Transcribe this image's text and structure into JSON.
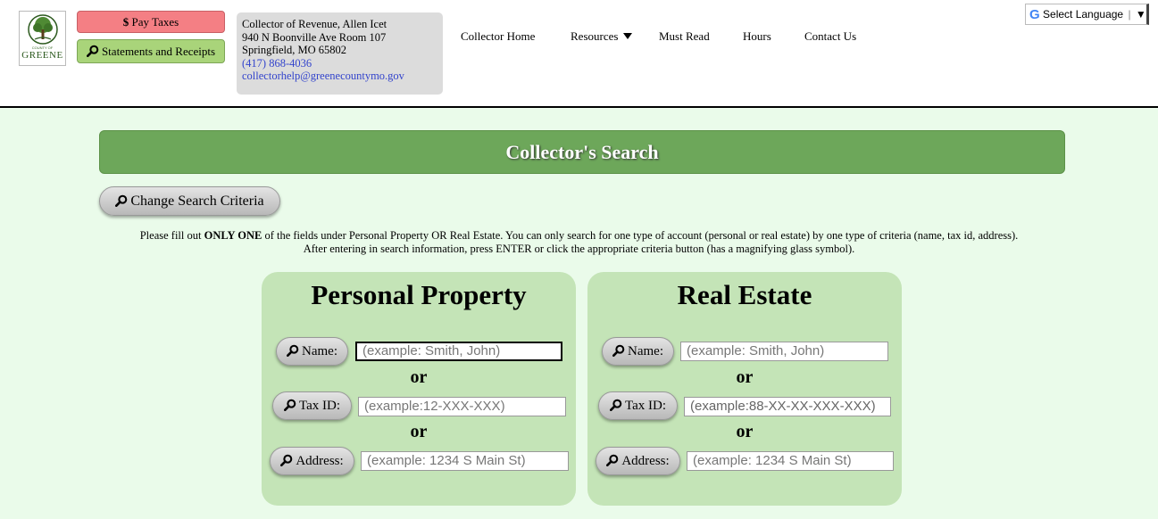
{
  "logo": {
    "county_text": "COUNTY OF",
    "name": "GREENE"
  },
  "header": {
    "pay_taxes": {
      "symbol": "$",
      "label": "Pay Taxes"
    },
    "statements": "Statements and Receipts",
    "contact": {
      "line1": "Collector of Revenue, Allen Icet",
      "line2": "940 N Boonville Ave Room 107",
      "line3": "Springfield, MO 65802",
      "phone": "(417) 868-4036",
      "email": "collectorhelp@greenecountymo.gov"
    },
    "nav": {
      "home": "Collector Home",
      "resources": "Resources",
      "must_read": "Must Read",
      "hours": "Hours",
      "contact_us": "Contact Us"
    },
    "language": {
      "g": "G",
      "label": "Select Language",
      "arrow": "▼"
    }
  },
  "main": {
    "banner": "Collector's Search",
    "change_criteria": "Change Search Criteria",
    "instructions": {
      "pre": "Please fill out ",
      "bold": "ONLY ONE",
      "post": " of the fields under Personal Property OR Real Estate. You can only search for one type of account (personal or real estate) by one type of criteria (name, tax id, address).",
      "line2": "After entering in search information, press ENTER or click the appropriate criteria button (has a magnifying glass symbol)."
    },
    "or_text": "or",
    "personal": {
      "title": "Personal Property",
      "name_label": "Name:",
      "name_placeholder": "(example: Smith, John)",
      "taxid_label": "Tax ID:",
      "taxid_placeholder": "(example:12-XXX-XXX)",
      "address_label": "Address:",
      "address_placeholder": "(example: 1234 S Main St)"
    },
    "real": {
      "title": "Real Estate",
      "name_label": "Name:",
      "name_placeholder": "(example: Smith, John)",
      "taxid_label": "Tax ID:",
      "taxid_placeholder": "(example:88-XX-XX-XXX-XXX)",
      "address_label": "Address:",
      "address_placeholder": "(example: 1234 S Main St)"
    }
  },
  "colors": {
    "pay_button": "#f47f84",
    "statements_button": "#a9d47a",
    "banner": "#6da75a",
    "panel": "#c4e4b7",
    "page_background": "#eafbea",
    "link": "#3344cc"
  }
}
